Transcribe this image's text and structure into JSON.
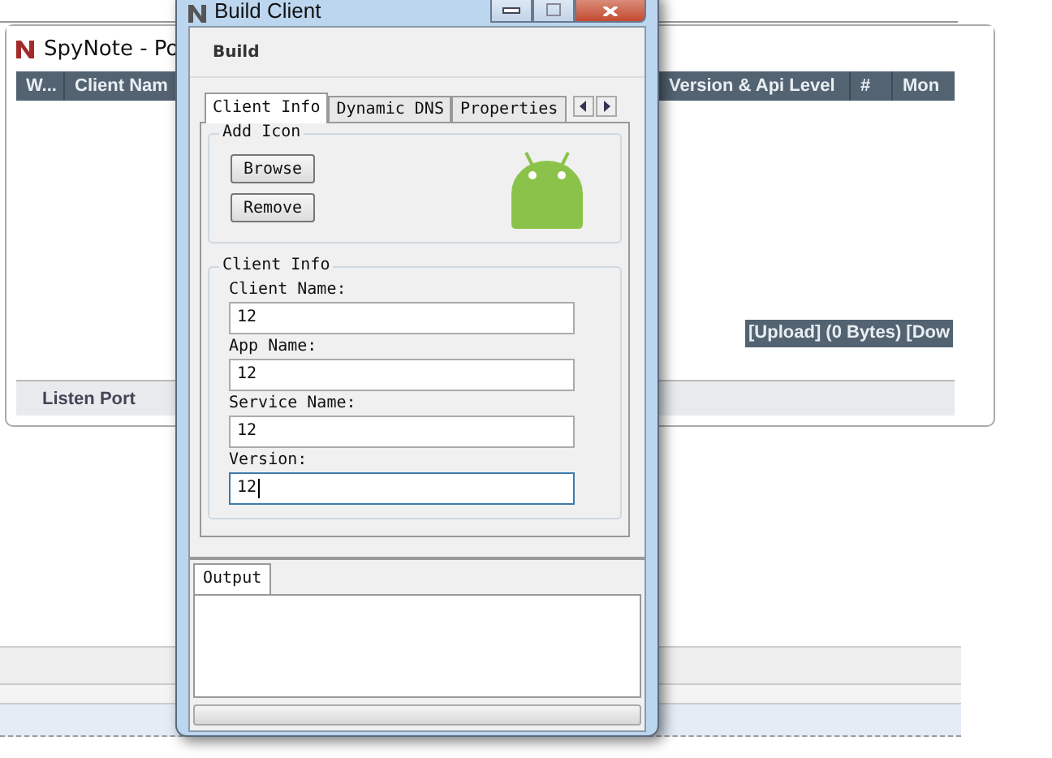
{
  "background_window": {
    "title": "SpyNote - Po",
    "columns": [
      "W...",
      "Client Nam",
      "Version & Api Level",
      "#",
      "Mon"
    ],
    "transfer_status": "[Upload] (0 Bytes) [Dow",
    "bottom_tabs": [
      "Listen Port"
    ]
  },
  "dialog": {
    "title": "Build Client",
    "menu": [
      "Build"
    ],
    "tabs": [
      {
        "label": "Client Info",
        "selected": true
      },
      {
        "label": "Dynamic DNS",
        "selected": false
      },
      {
        "label": "Properties",
        "selected": false
      }
    ],
    "add_icon": {
      "title": "Add Icon",
      "buttons": [
        "Browse",
        "Remove"
      ]
    },
    "client_info": {
      "title": "Client Info",
      "fields": [
        {
          "label": "Client Name:",
          "value": "12",
          "focused": false
        },
        {
          "label": "App Name:",
          "value": "12",
          "focused": false
        },
        {
          "label": "Service Name:",
          "value": "12",
          "focused": false
        },
        {
          "label": "Version:",
          "value": "12",
          "focused": true
        }
      ]
    },
    "output": {
      "tab": "Output"
    },
    "progress": {
      "level": 0
    }
  }
}
